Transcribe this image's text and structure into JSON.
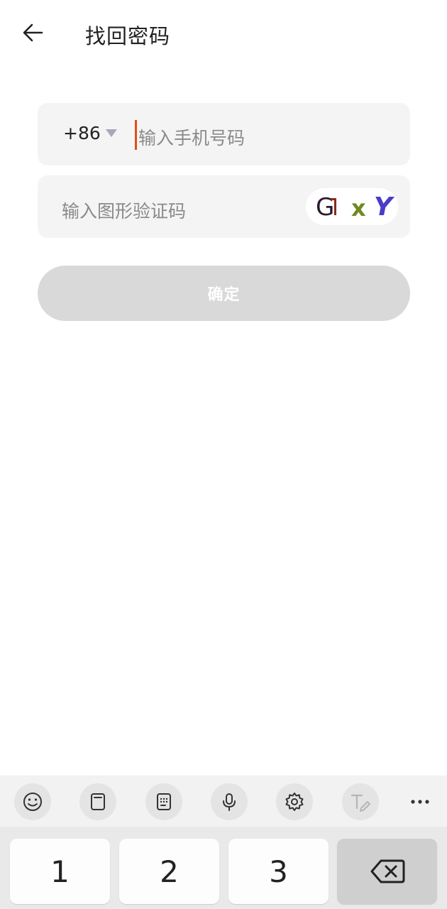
{
  "header": {
    "title": "找回密码",
    "back_icon": "arrow-left-icon"
  },
  "phone_field": {
    "country_code": "+86",
    "placeholder": "输入手机号码"
  },
  "captcha_field": {
    "placeholder": "输入图形验证码",
    "image_text": "GlxY"
  },
  "confirm_button": {
    "label": "确定"
  },
  "keyboard": {
    "toolbar_icons": [
      "emoji-icon",
      "clipboard-icon",
      "keypad-icon",
      "microphone-icon",
      "settings-icon",
      "handwriting-icon",
      "more-icon"
    ],
    "keys": [
      "1",
      "2",
      "3"
    ],
    "delete_icon": "backspace-icon"
  },
  "colors": {
    "cursor": "#e64a19",
    "field_bg": "#f4f4f4",
    "button_disabled_bg": "#d9d9d9"
  }
}
